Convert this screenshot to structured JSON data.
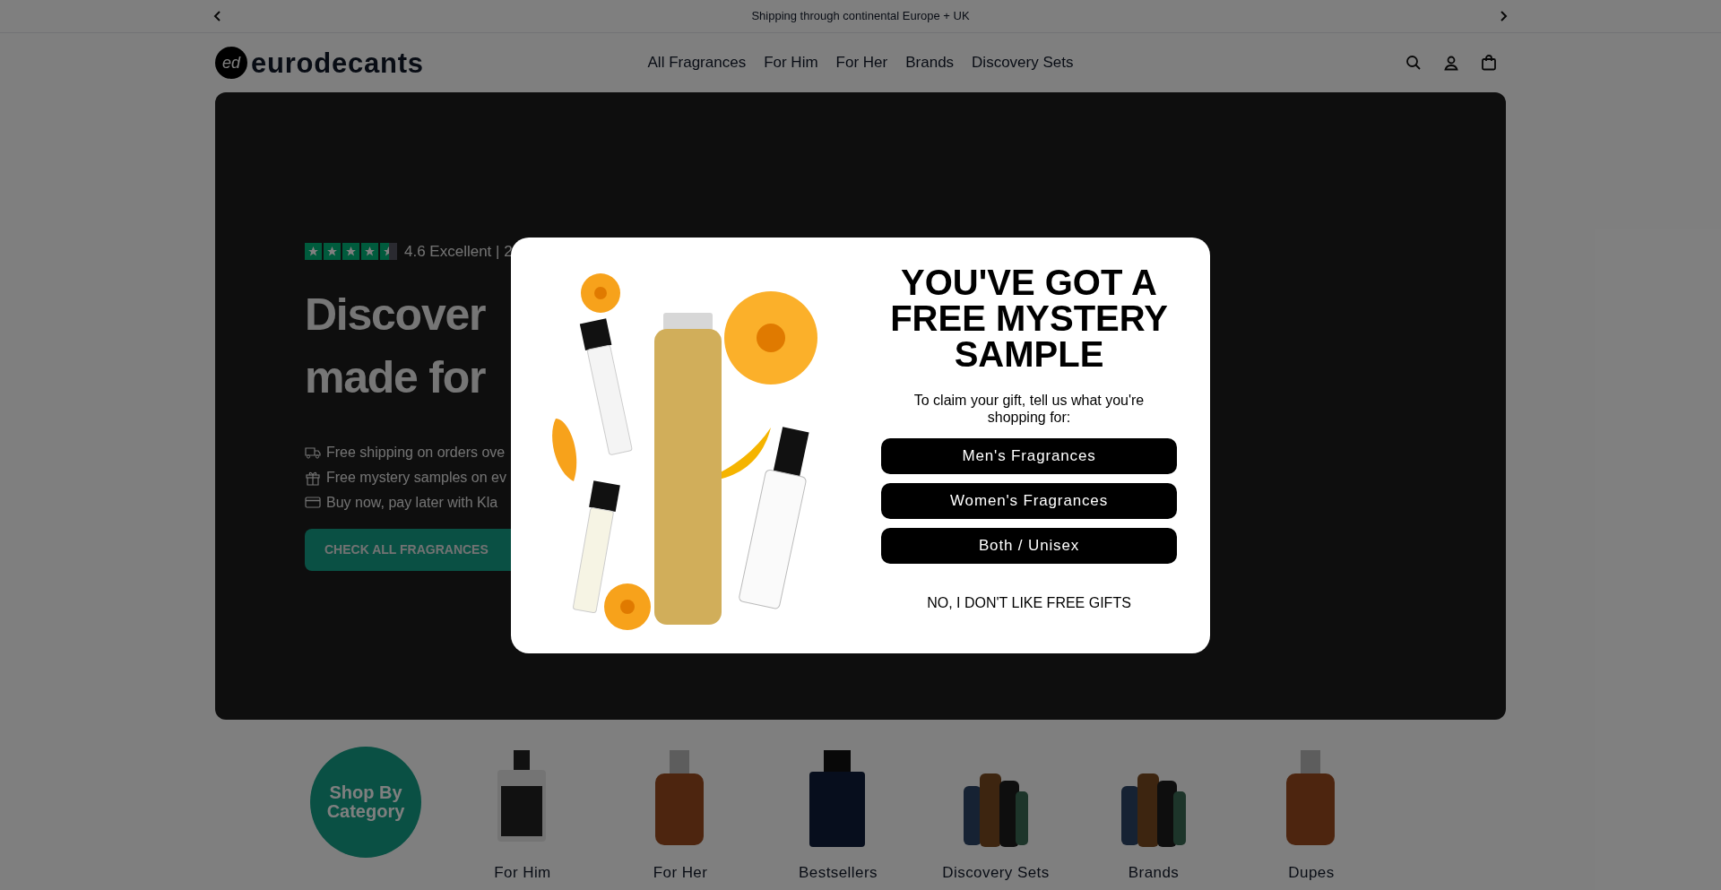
{
  "announcement_bar": {
    "text": "Shipping through continental Europe + UK"
  },
  "header": {
    "logo": {
      "mark": "ed",
      "name": "eurodecants"
    },
    "nav": [
      "All Fragrances",
      "For Him",
      "For Her",
      "Brands",
      "Discovery Sets"
    ]
  },
  "hero": {
    "rating": {
      "stars": 4.5,
      "text": "4.6 Excellent | 2"
    },
    "heading": [
      "Discover",
      "made for"
    ],
    "features": [
      {
        "kind": "truck",
        "text": "Free shipping on orders ove"
      },
      {
        "kind": "gift",
        "text": "Free mystery samples on ev"
      },
      {
        "kind": "card",
        "text": "Buy now, pay later with Kla"
      }
    ],
    "button": "CHECK ALL FRAGRANCES"
  },
  "categories": {
    "badge": "Shop By Category",
    "items": [
      {
        "label": "For Him",
        "kind": "clear"
      },
      {
        "label": "For Her",
        "kind": "brown"
      },
      {
        "label": "Bestsellers",
        "kind": "navy"
      },
      {
        "label": "Discovery Sets",
        "kind": "set"
      },
      {
        "label": "Brands",
        "kind": "set"
      },
      {
        "label": "Dupes",
        "kind": "brown"
      }
    ]
  },
  "popup": {
    "title": "YOU'VE GOT A FREE MYSTERY SAMPLE",
    "subtitle": "To claim your gift, tell us what you're shopping for:",
    "options": [
      "Men's Fragrances",
      "Women's Fragrances",
      "Both / Unisex"
    ],
    "decline": "NO, I DON'T LIKE FREE GIFTS"
  }
}
